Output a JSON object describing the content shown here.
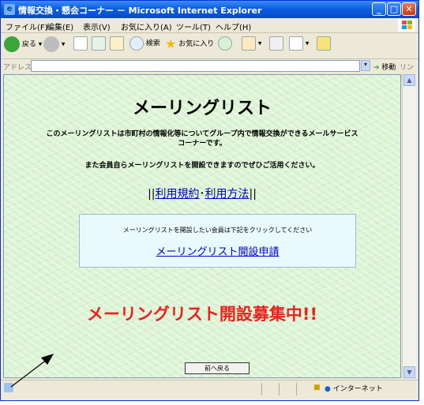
{
  "window": {
    "title": "情報交換・懇会コーナー － Microsoft Internet Explorer"
  },
  "menu": [
    "ファイル(F)",
    "編集(E)",
    "表示(V)",
    "お気に入り(A)",
    "ツール(T)",
    "ヘルプ(H)"
  ],
  "toolbar": {
    "back": "戻る",
    "search": "検索",
    "favorites": "お気に入り"
  },
  "address": {
    "label": "アドレス(D)",
    "value": "",
    "go": "移動",
    "links": "リンク"
  },
  "page": {
    "title": "メーリングリスト",
    "desc1": "このメーリングリストは市町村の情報化等についてグループ内で情報交換ができるメールサービス",
    "desc2": "コーナーです。",
    "desc3": "また会員自らメーリングリストを開設できますのでぜひご活用ください。",
    "link_bracket_left": "||",
    "link_terms": "利用規約",
    "link_sep": "･",
    "link_howto": "利用方法",
    "link_bracket_right": "||",
    "box_instruction": "メーリングリストを開設したい会員は下記をクリックしてください",
    "apply_link": "メーリングリスト開設申請",
    "recruit": "メーリングリスト開設募集中!!",
    "back_button": "前へ戻る"
  },
  "status": {
    "zone": "インターネット"
  }
}
